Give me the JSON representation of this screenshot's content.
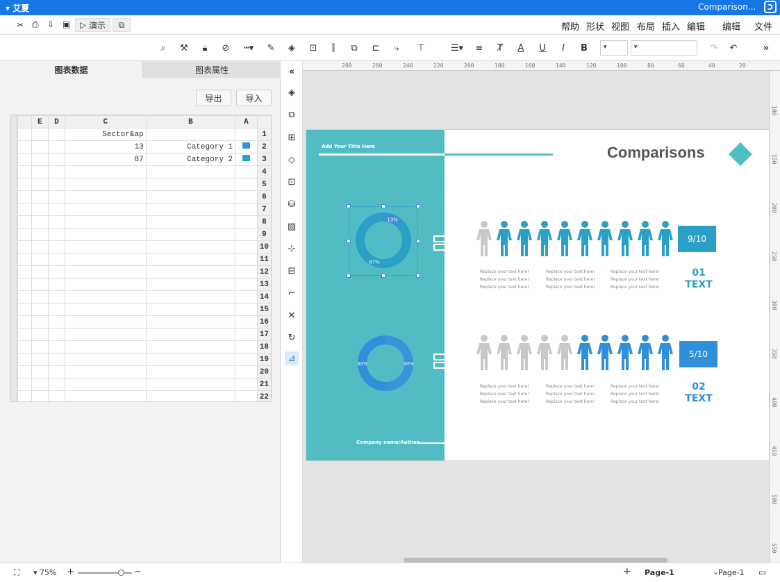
{
  "titlebar": {
    "app_menu": "文件",
    "doc_title": "Comparison...",
    "user": "艾夏"
  },
  "menubar": {
    "items": [
      "文件",
      "编辑",
      "插入",
      "布局",
      "视图",
      "形状",
      "帮助"
    ],
    "present": "演示"
  },
  "toolbar": {
    "font": "",
    "size": ""
  },
  "panel": {
    "tab_data": "图表数据",
    "tab_props": "图表属性",
    "import_label": "导入",
    "export_label": "导出",
    "columns": [
      "A",
      "B",
      "C",
      "D",
      "E"
    ],
    "rows": [
      {
        "n": "1",
        "a": "",
        "b": "Sector&ap",
        "swatch": ""
      },
      {
        "n": "2",
        "a": "Category 1",
        "b": "13",
        "swatch": "#3d8fd6"
      },
      {
        "n": "3",
        "a": "Category 2",
        "b": "87",
        "swatch": "#2aa0c6"
      },
      {
        "n": "4"
      },
      {
        "n": "5"
      },
      {
        "n": "6"
      },
      {
        "n": "7"
      },
      {
        "n": "8"
      },
      {
        "n": "9"
      },
      {
        "n": "10"
      },
      {
        "n": "11"
      },
      {
        "n": "12"
      },
      {
        "n": "13"
      },
      {
        "n": "14"
      },
      {
        "n": "15"
      },
      {
        "n": "16"
      },
      {
        "n": "17"
      },
      {
        "n": "18"
      },
      {
        "n": "19"
      },
      {
        "n": "20"
      },
      {
        "n": "21"
      },
      {
        "n": "22"
      }
    ]
  },
  "ruler": {
    "top": [
      "20",
      "40",
      "60",
      "80",
      "100",
      "120",
      "140",
      "160",
      "180",
      "200",
      "220",
      "240",
      "260",
      "280"
    ],
    "left": [
      "100",
      "150",
      "200",
      "250",
      "300",
      "350",
      "400",
      "450",
      "500",
      "550"
    ]
  },
  "slide": {
    "title": "Comparisons",
    "add_title": "Add Your Title Here",
    "author": "Company name/Author",
    "row1": {
      "badge": "9/10",
      "num": "01",
      "text": "TEXT",
      "donut_labels": [
        "13%",
        "87%"
      ],
      "donut_values": [
        13,
        87
      ]
    },
    "row2": {
      "badge": "5/10",
      "num": "02",
      "text": "TEXT",
      "donut_labels": [
        "50%",
        "50%"
      ],
      "donut_values": [
        50,
        50
      ]
    },
    "replace": "Replace your text here!",
    "colors": {
      "teal": "#52bcc4",
      "blue": "#2f8fd8",
      "teal_dark": "#2aa0c6",
      "gray": "#c8c8c8",
      "diamond": "#4dbfbf"
    }
  },
  "status": {
    "page_tab": "Page-1",
    "page_label": "Page-1",
    "zoom": "75%"
  }
}
